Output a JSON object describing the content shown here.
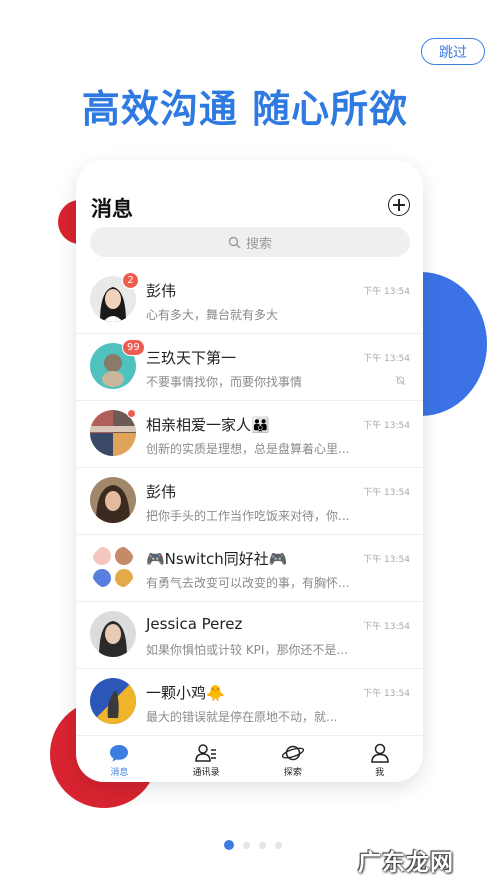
{
  "skip_label": "跳过",
  "headline": "高效沟通 随心所欲",
  "phone": {
    "title": "消息",
    "search_placeholder": "搜索",
    "messages": [
      {
        "name": "彭伟",
        "preview": "心有多大，舞台就有多大",
        "time": "下午 13:54",
        "badge": "2"
      },
      {
        "name": "三玖天下第一",
        "preview": "不要事情找你，而要你找事情",
        "time": "下午 13:54",
        "badge": "99",
        "muted": true
      },
      {
        "name": "相亲相爱一家人👪",
        "preview": "创新的实质是理想，总是盘算着心里...",
        "time": "下午 13:54",
        "dot": true
      },
      {
        "name": "彭伟",
        "preview": "把你手头的工作当作吃饭来对待，你...",
        "time": "下午 13:54"
      },
      {
        "name": "🎮Nswitch同好社🎮",
        "preview": "有勇气去改变可以改变的事，有胸怀...",
        "time": "下午 13:54"
      },
      {
        "name": "Jessica Perez",
        "preview": "如果你惧怕或计较 KPI，那你还不是...",
        "time": "下午 13:54"
      },
      {
        "name": "一颗小鸡🐥",
        "preview": "最大的错误就是停在原地不动，就...",
        "time": "下午 13:54"
      }
    ],
    "tabs": [
      {
        "label": "消息",
        "icon": "chat-icon",
        "active": true
      },
      {
        "label": "通讯录",
        "icon": "contacts-icon"
      },
      {
        "label": "探索",
        "icon": "planet-icon"
      },
      {
        "label": "我",
        "icon": "person-icon"
      }
    ]
  },
  "pagination": {
    "total": 4,
    "current": 1
  },
  "watermark": "广东龙网",
  "colors": {
    "accent": "#3b7de0",
    "red": "#d82430",
    "badge": "#ef5b4f"
  }
}
